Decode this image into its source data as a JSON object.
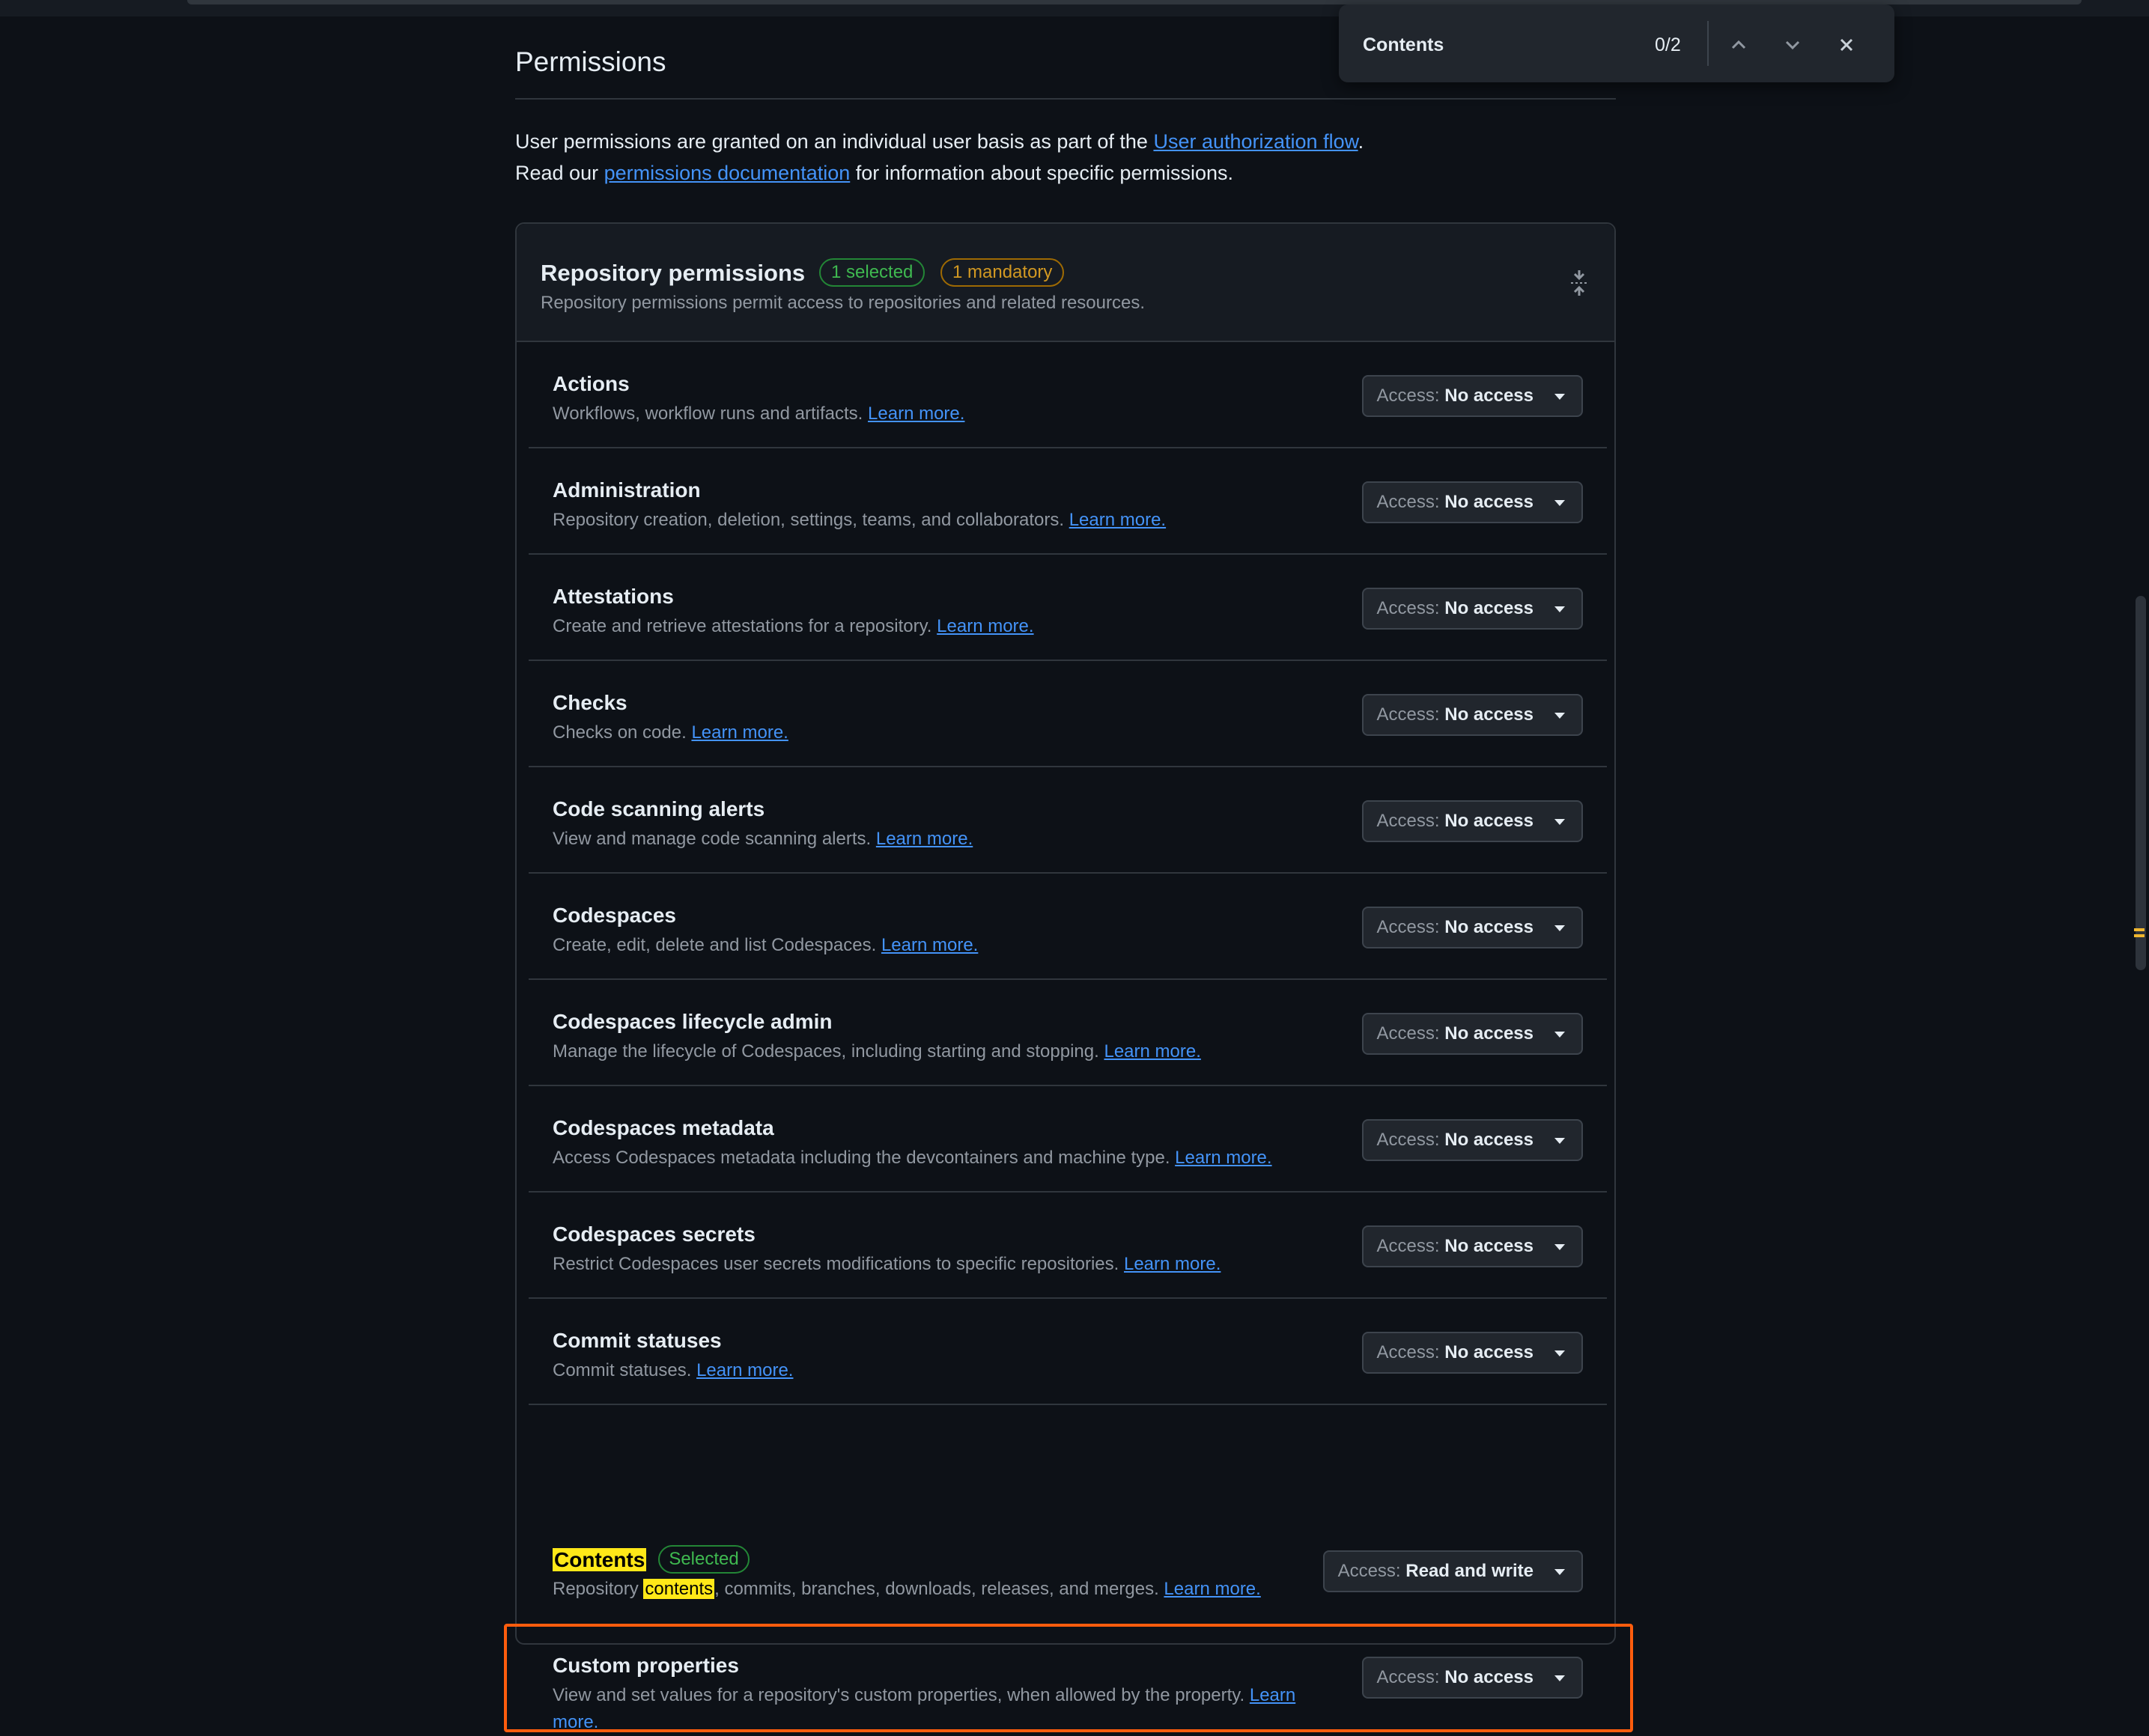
{
  "find_bar": {
    "query": "Contents",
    "count": "0/2",
    "prev_icon": "chevron-up-icon",
    "next_icon": "chevron-down-icon",
    "close_icon": "close-icon"
  },
  "section": {
    "title": "Permissions",
    "intro_line1_pre": "User permissions are granted on an individual user basis as part of the ",
    "intro_link1": "User authorization flow",
    "intro_line1_post": ".",
    "intro_line2_pre": "Read our ",
    "intro_link2": "permissions documentation",
    "intro_line2_post": " for information about specific permissions."
  },
  "panel": {
    "title": "Repository permissions",
    "badge_selected": "1 selected",
    "badge_mandatory": "1 mandatory",
    "description": "Repository permissions permit access to repositories and related resources.",
    "collapse_icon": "fold-icon"
  },
  "access_prefix": "Access:",
  "rows": [
    {
      "name": "Actions",
      "desc": "Workflows, workflow runs and artifacts.",
      "link": "Learn more.",
      "access": "No access"
    },
    {
      "name": "Administration",
      "desc": "Repository creation, deletion, settings, teams, and collaborators.",
      "link": "Learn more.",
      "access": "No access"
    },
    {
      "name": "Attestations",
      "desc": "Create and retrieve attestations for a repository.",
      "link": "Learn more.",
      "access": "No access"
    },
    {
      "name": "Checks",
      "desc": "Checks on code.",
      "link": "Learn more.",
      "access": "No access"
    },
    {
      "name": "Code scanning alerts",
      "desc": "View and manage code scanning alerts.",
      "link": "Learn more.",
      "access": "No access"
    },
    {
      "name": "Codespaces",
      "desc": "Create, edit, delete and list Codespaces.",
      "link": "Learn more.",
      "access": "No access"
    },
    {
      "name": "Codespaces lifecycle admin",
      "desc": "Manage the lifecycle of Codespaces, including starting and stopping.",
      "link": "Learn more.",
      "access": "No access"
    },
    {
      "name": "Codespaces metadata",
      "desc": "Access Codespaces metadata including the devcontainers and machine type.",
      "link": "Learn more.",
      "access": "No access"
    },
    {
      "name": "Codespaces secrets",
      "desc": "Restrict Codespaces user secrets modifications to specific repositories.",
      "link": "Learn more.",
      "access": "No access"
    },
    {
      "name": "Commit statuses",
      "desc": "Commit statuses.",
      "link": "Learn more.",
      "access": "No access"
    }
  ],
  "contents_row": {
    "name": "Contents",
    "badge": "Selected",
    "desc_pre": "Repository ",
    "desc_highlight": "contents",
    "desc_post": ", commits, branches, downloads, releases, and merges.",
    "link": "Learn more.",
    "access": "Read and write"
  },
  "custom_row": {
    "name": "Custom properties",
    "desc": "View and set values for a repository's custom properties, when allowed by the property.",
    "link": "Learn more.",
    "access": "No access"
  },
  "colors": {
    "background": "#0d1117",
    "link": "#4493f8",
    "highlight": "#ffe818",
    "focus_outline": "#ff5d0d",
    "selected_green": "#3fb950",
    "mandatory_amber": "#d29922"
  }
}
